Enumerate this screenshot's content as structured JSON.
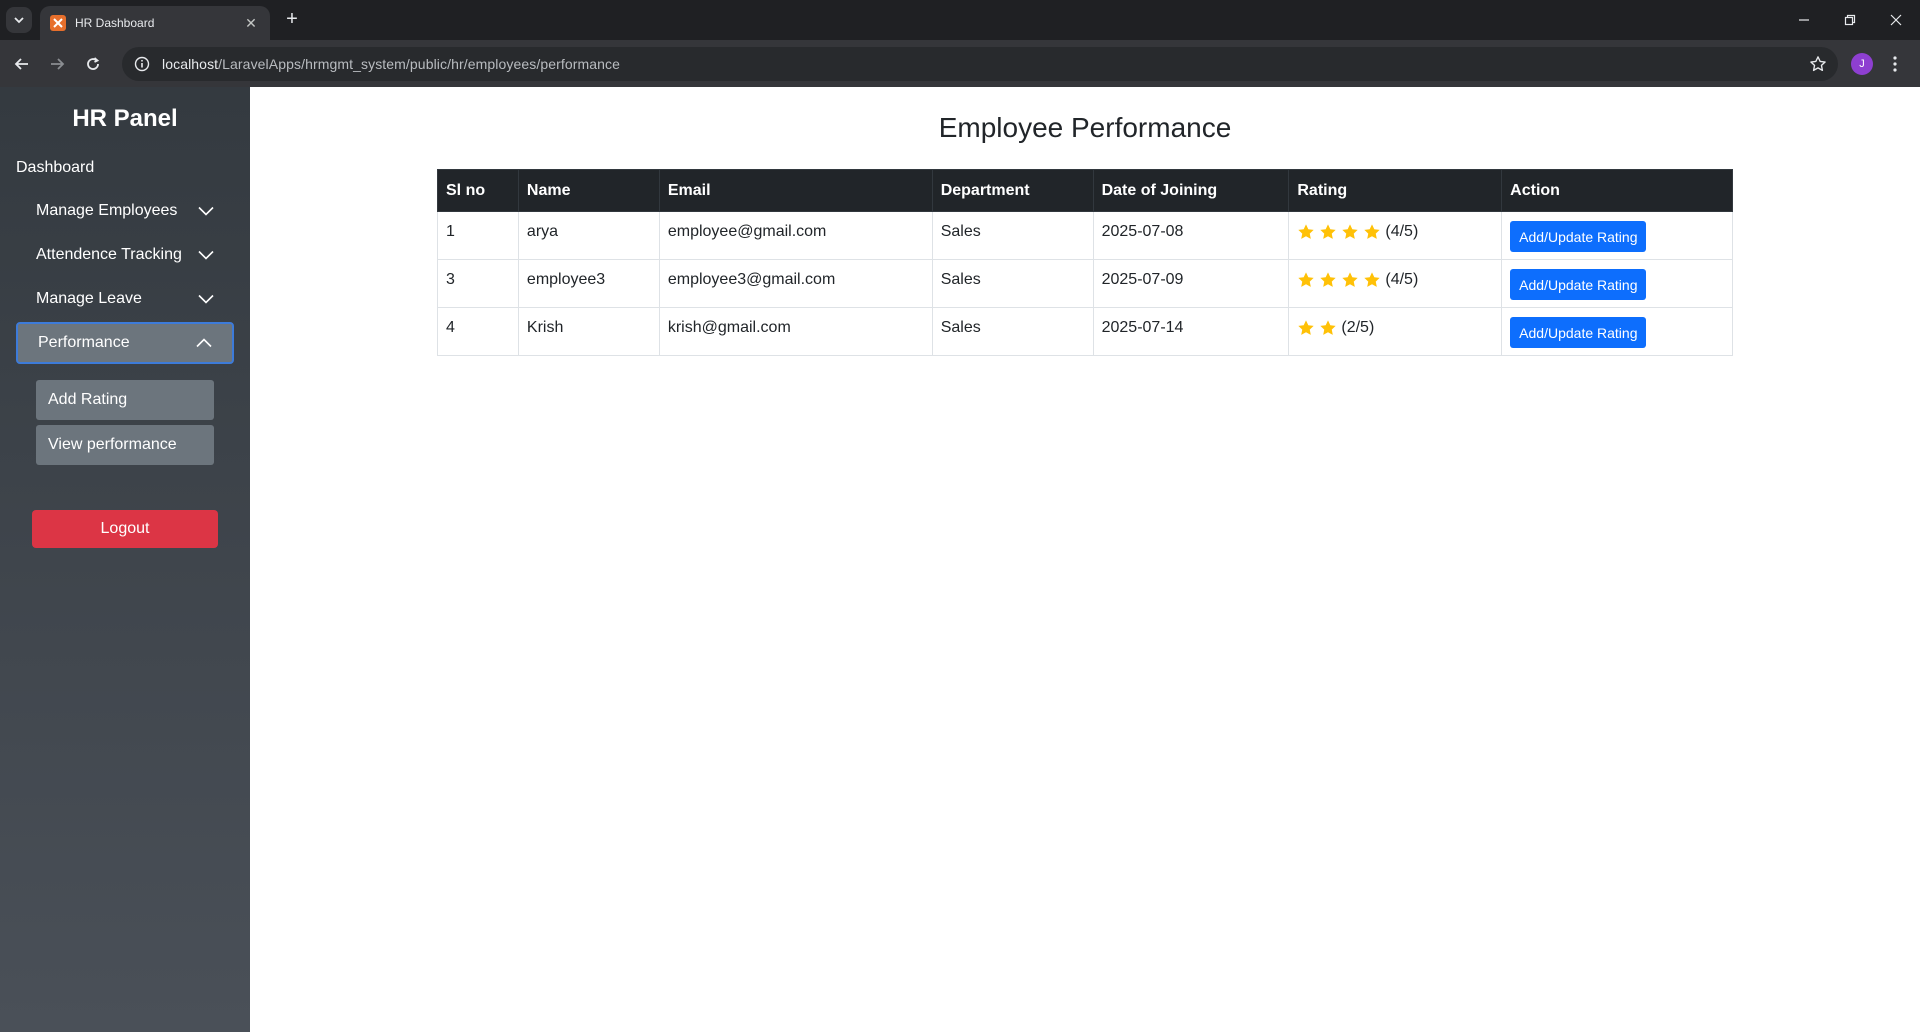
{
  "browser": {
    "tab_title": "HR Dashboard",
    "url_host": "localhost",
    "url_path": "/LaravelApps/hrmgmt_system/public/hr/employees/performance",
    "profile_initial": "J"
  },
  "sidebar": {
    "title": "HR Panel",
    "dashboard_label": "Dashboard",
    "menu": [
      {
        "label": "Manage Employees",
        "expanded": false
      },
      {
        "label": "Attendence Tracking",
        "expanded": false
      },
      {
        "label": "Manage Leave",
        "expanded": false
      },
      {
        "label": "Performance",
        "expanded": true
      }
    ],
    "submenu": [
      {
        "label": "Add Rating"
      },
      {
        "label": "View performance"
      }
    ],
    "logout_label": "Logout"
  },
  "main": {
    "title": "Employee Performance",
    "columns": [
      "Sl no",
      "Name",
      "Email",
      "Department",
      "Date of Joining",
      "Rating",
      "Action"
    ],
    "rows": [
      {
        "sl": "1",
        "name": "arya",
        "email": "employee@gmail.com",
        "department": "Sales",
        "doj": "2025-07-08",
        "stars": 4,
        "rating_text": "(4/5)",
        "action": "Add/Update Rating"
      },
      {
        "sl": "3",
        "name": "employee3",
        "email": "employee3@gmail.com",
        "department": "Sales",
        "doj": "2025-07-09",
        "stars": 4,
        "rating_text": "(4/5)",
        "action": "Add/Update Rating"
      },
      {
        "sl": "4",
        "name": "Krish",
        "email": "krish@gmail.com",
        "department": "Sales",
        "doj": "2025-07-14",
        "stars": 2,
        "rating_text": "(2/5)",
        "action": "Add/Update Rating"
      }
    ]
  },
  "colors": {
    "star": "#ffc107",
    "primary": "#0d6efd",
    "danger": "#dc3545",
    "table_header": "#212529"
  }
}
